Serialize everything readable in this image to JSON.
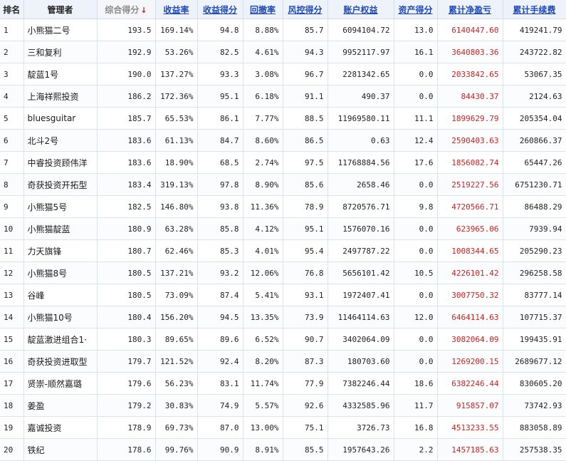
{
  "headers": {
    "rank": "排名",
    "manager": "管理者",
    "total_score": "综合得分",
    "sort_arrow": "↓",
    "return_rate": "收益率",
    "return_score": "收益得分",
    "drawdown": "回撤率",
    "risk_score": "风控得分",
    "equity": "账户权益",
    "asset_score": "资产得分",
    "net_pnl": "累计净盈亏",
    "fees": "累计手续费"
  },
  "colors": {
    "link_header": "#1f49b8",
    "loss_profit_red": "#d32222",
    "sort_arrow": "#d41c1c"
  },
  "rows": [
    {
      "rank": "1",
      "manager": "小熊猫二号",
      "total": "193.5",
      "rate": "169.14%",
      "rscore": "94.8",
      "dd": "8.88%",
      "risk": "85.7",
      "equity": "6094104.72",
      "asset": "13.0",
      "pnl": "6140447.60",
      "fee": "419241.79"
    },
    {
      "rank": "2",
      "manager": "三和复利",
      "total": "192.9",
      "rate": "53.26%",
      "rscore": "82.5",
      "dd": "4.61%",
      "risk": "94.3",
      "equity": "9952117.97",
      "asset": "16.1",
      "pnl": "3640803.36",
      "fee": "243722.82"
    },
    {
      "rank": "3",
      "manager": "靛蓝1号",
      "total": "190.0",
      "rate": "137.27%",
      "rscore": "93.3",
      "dd": "3.08%",
      "risk": "96.7",
      "equity": "2281342.65",
      "asset": "0.0",
      "pnl": "2033842.65",
      "fee": "53067.35"
    },
    {
      "rank": "4",
      "manager": "上海祥熙投资",
      "total": "186.2",
      "rate": "172.36%",
      "rscore": "95.1",
      "dd": "6.18%",
      "risk": "91.1",
      "equity": "490.37",
      "asset": "0.0",
      "pnl": "84430.37",
      "fee": "2124.63"
    },
    {
      "rank": "5",
      "manager": "bluesguitar",
      "total": "185.7",
      "rate": "65.53%",
      "rscore": "86.1",
      "dd": "7.77%",
      "risk": "88.5",
      "equity": "11969580.11",
      "asset": "11.1",
      "pnl": "1899629.79",
      "fee": "205354.04"
    },
    {
      "rank": "6",
      "manager": "北斗2号",
      "total": "183.6",
      "rate": "61.13%",
      "rscore": "84.7",
      "dd": "8.60%",
      "risk": "86.5",
      "equity": "0.63",
      "asset": "12.4",
      "pnl": "2590403.63",
      "fee": "260866.37"
    },
    {
      "rank": "7",
      "manager": "中睿投资顾伟洋",
      "total": "183.6",
      "rate": "18.90%",
      "rscore": "68.5",
      "dd": "2.74%",
      "risk": "97.5",
      "equity": "11768884.56",
      "asset": "17.6",
      "pnl": "1856082.74",
      "fee": "65447.26"
    },
    {
      "rank": "8",
      "manager": "奇获投资开拓型",
      "total": "183.4",
      "rate": "319.13%",
      "rscore": "97.8",
      "dd": "8.90%",
      "risk": "85.6",
      "equity": "2658.46",
      "asset": "0.0",
      "pnl": "2519227.56",
      "fee": "6751230.71"
    },
    {
      "rank": "9",
      "manager": "小熊猫5号",
      "total": "182.5",
      "rate": "146.80%",
      "rscore": "93.8",
      "dd": "11.36%",
      "risk": "78.9",
      "equity": "8720576.71",
      "asset": "9.8",
      "pnl": "4720566.71",
      "fee": "86488.29"
    },
    {
      "rank": "10",
      "manager": "小熊猫靛蓝",
      "total": "180.9",
      "rate": "63.28%",
      "rscore": "85.8",
      "dd": "4.12%",
      "risk": "95.1",
      "equity": "1576070.16",
      "asset": "0.0",
      "pnl": "623965.06",
      "fee": "7939.94"
    },
    {
      "rank": "11",
      "manager": "力天旗锋",
      "total": "180.7",
      "rate": "62.46%",
      "rscore": "85.3",
      "dd": "4.01%",
      "risk": "95.4",
      "equity": "2497787.22",
      "asset": "0.0",
      "pnl": "1008344.65",
      "fee": "205290.23"
    },
    {
      "rank": "12",
      "manager": "小熊猫8号",
      "total": "180.5",
      "rate": "137.21%",
      "rscore": "93.2",
      "dd": "12.06%",
      "risk": "76.8",
      "equity": "5656101.42",
      "asset": "10.5",
      "pnl": "4226101.42",
      "fee": "296258.58"
    },
    {
      "rank": "13",
      "manager": "谷峰",
      "total": "180.5",
      "rate": "73.09%",
      "rscore": "87.4",
      "dd": "5.41%",
      "risk": "93.1",
      "equity": "1972407.41",
      "asset": "0.0",
      "pnl": "3007750.32",
      "fee": "83777.14"
    },
    {
      "rank": "14",
      "manager": "小熊猫10号",
      "total": "180.4",
      "rate": "156.20%",
      "rscore": "94.5",
      "dd": "13.35%",
      "risk": "73.9",
      "equity": "11464114.63",
      "asset": "12.0",
      "pnl": "6464114.63",
      "fee": "107715.37"
    },
    {
      "rank": "15",
      "manager": "靛蓝激进组合1·",
      "total": "180.3",
      "rate": "89.65%",
      "rscore": "89.6",
      "dd": "6.52%",
      "risk": "90.7",
      "equity": "3402064.09",
      "asset": "0.0",
      "pnl": "3082064.09",
      "fee": "199435.91"
    },
    {
      "rank": "16",
      "manager": "奇获投资进取型",
      "total": "179.7",
      "rate": "121.52%",
      "rscore": "92.4",
      "dd": "8.20%",
      "risk": "87.3",
      "equity": "180703.60",
      "asset": "0.0",
      "pnl": "1269200.15",
      "fee": "2689677.12"
    },
    {
      "rank": "17",
      "manager": "贤崇-顺然嘉璐",
      "total": "179.6",
      "rate": "56.23%",
      "rscore": "83.1",
      "dd": "11.74%",
      "risk": "77.9",
      "equity": "7382246.44",
      "asset": "18.6",
      "pnl": "6382246.44",
      "fee": "830605.20"
    },
    {
      "rank": "18",
      "manager": "姜盈",
      "total": "179.2",
      "rate": "30.83%",
      "rscore": "74.9",
      "dd": "5.57%",
      "risk": "92.6",
      "equity": "4332585.96",
      "asset": "11.7",
      "pnl": "915857.07",
      "fee": "73742.93"
    },
    {
      "rank": "19",
      "manager": "嘉诚投资",
      "total": "178.9",
      "rate": "69.73%",
      "rscore": "87.0",
      "dd": "13.00%",
      "risk": "75.1",
      "equity": "3726.73",
      "asset": "16.8",
      "pnl": "4513233.55",
      "fee": "883058.89"
    },
    {
      "rank": "20",
      "manager": "铁纪",
      "total": "178.6",
      "rate": "99.76%",
      "rscore": "90.9",
      "dd": "8.91%",
      "risk": "85.5",
      "equity": "1957643.26",
      "asset": "2.2",
      "pnl": "1457185.63",
      "fee": "257538.35"
    }
  ]
}
